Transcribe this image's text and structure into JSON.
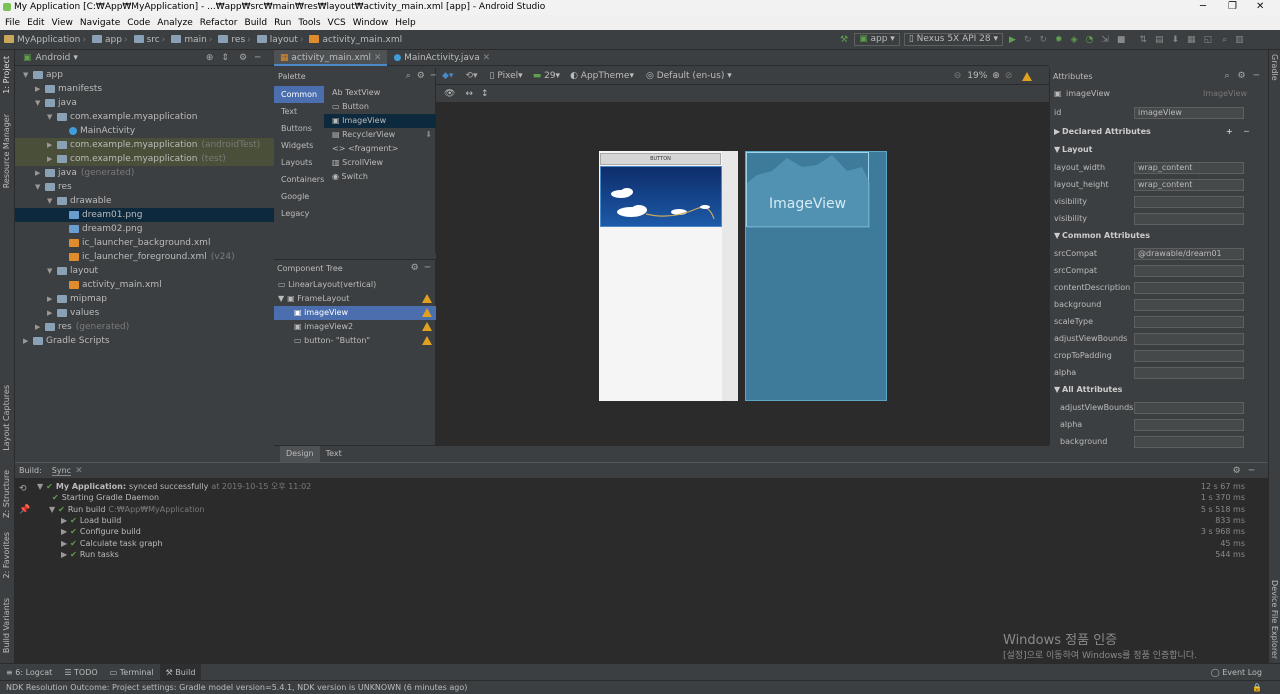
{
  "window": {
    "title": "My Application [C:₩App₩MyApplication] - ...₩app₩src₩main₩res₩layout₩activity_main.xml [app] - Android Studio"
  },
  "menu": [
    "File",
    "Edit",
    "View",
    "Navigate",
    "Code",
    "Analyze",
    "Refactor",
    "Build",
    "Run",
    "Tools",
    "VCS",
    "Window",
    "Help"
  ],
  "breadcrumbs": [
    "MyApplication",
    "app",
    "src",
    "main",
    "res",
    "layout",
    "activity_main.xml"
  ],
  "toolbar": {
    "config": "app",
    "device": "Nexus 5X API 28"
  },
  "project": {
    "view": "Android",
    "items": [
      {
        "label": "app",
        "indent": 0,
        "icon": "folder",
        "open": true
      },
      {
        "label": "manifests",
        "indent": 1,
        "icon": "folder"
      },
      {
        "label": "java",
        "indent": 1,
        "icon": "folder",
        "open": true
      },
      {
        "label": "com.example.myapplication",
        "indent": 2,
        "icon": "folder",
        "open": true
      },
      {
        "label": "MainActivity",
        "indent": 3,
        "icon": "class"
      },
      {
        "label": "com.example.myapplication",
        "suffix": "(androidTest)",
        "indent": 2,
        "icon": "folder",
        "hl": true
      },
      {
        "label": "com.example.myapplication",
        "suffix": "(test)",
        "indent": 2,
        "icon": "folder",
        "hl": true
      },
      {
        "label": "java",
        "suffix": "(generated)",
        "indent": 1,
        "icon": "folder"
      },
      {
        "label": "res",
        "indent": 1,
        "icon": "folder",
        "open": true
      },
      {
        "label": "drawable",
        "indent": 2,
        "icon": "folder",
        "open": true
      },
      {
        "label": "dream01.png",
        "indent": 3,
        "icon": "image",
        "sel": true
      },
      {
        "label": "dream02.png",
        "indent": 3,
        "icon": "image"
      },
      {
        "label": "ic_launcher_background.xml",
        "indent": 3,
        "icon": "xml"
      },
      {
        "label": "ic_launcher_foreground.xml",
        "suffix": "(v24)",
        "indent": 3,
        "icon": "xml"
      },
      {
        "label": "layout",
        "indent": 2,
        "icon": "folder",
        "open": true
      },
      {
        "label": "activity_main.xml",
        "indent": 3,
        "icon": "xml"
      },
      {
        "label": "mipmap",
        "indent": 2,
        "icon": "folder"
      },
      {
        "label": "values",
        "indent": 2,
        "icon": "folder"
      },
      {
        "label": "res",
        "suffix": "(generated)",
        "indent": 1,
        "icon": "folder"
      },
      {
        "label": "Gradle Scripts",
        "indent": 0,
        "icon": "gradle"
      }
    ]
  },
  "left_strip": {
    "project": "1: Project",
    "resource": "Resource Manager",
    "captures": "Layout Captures",
    "structure": "Z: Structure",
    "favorites": "2: Favorites",
    "variants": "Build Variants"
  },
  "right_strip": {
    "gradle": "Gradle",
    "device": "Device File Explorer"
  },
  "tabs": [
    "activity_main.xml",
    "MainActivity.java"
  ],
  "palette": {
    "title": "Palette",
    "categories": [
      "Common",
      "Text",
      "Buttons",
      "Widgets",
      "Layouts",
      "Containers",
      "Google",
      "Legacy"
    ],
    "items": [
      "Ab TextView",
      "Button",
      "ImageView",
      "RecyclerView",
      "<fragment>",
      "ScrollView",
      "Switch"
    ]
  },
  "component_tree": {
    "title": "Component Tree",
    "items": [
      "LinearLayout(vertical)",
      "FrameLayout",
      "imageView",
      "imageView2",
      "button- \"Button\""
    ]
  },
  "design_toolbar": {
    "pixel": "Pixel",
    "api": "29",
    "theme": "AppTheme",
    "locale": "Default (en-us)",
    "zoom": "19%"
  },
  "preview": {
    "button_label": "BUTTON",
    "blueprint_label": "ImageView"
  },
  "editor_tabs": [
    "Design",
    "Text"
  ],
  "attributes": {
    "title": "Attributes",
    "component": "imageView",
    "component_type": "ImageView",
    "id": "imageView",
    "sections": {
      "declared": "Declared Attributes",
      "layout": "Layout",
      "common": "Common Attributes",
      "all": "All Attributes"
    },
    "layout_rows": [
      {
        "k": "layout_width",
        "v": "wrap_content"
      },
      {
        "k": "layout_height",
        "v": "wrap_content"
      },
      {
        "k": "visibility",
        "v": ""
      },
      {
        "k": "visibility",
        "v": ""
      }
    ],
    "common_rows": [
      {
        "k": "srcCompat",
        "v": "@drawable/dream01"
      },
      {
        "k": "srcCompat",
        "v": ""
      },
      {
        "k": "contentDescription",
        "v": ""
      },
      {
        "k": "background",
        "v": ""
      },
      {
        "k": "scaleType",
        "v": ""
      },
      {
        "k": "adjustViewBounds",
        "v": ""
      },
      {
        "k": "cropToPadding",
        "v": ""
      },
      {
        "k": "alpha",
        "v": ""
      }
    ],
    "all_rows": [
      {
        "k": "adjustViewBounds",
        "v": ""
      },
      {
        "k": "alpha",
        "v": ""
      },
      {
        "k": "background",
        "v": ""
      }
    ]
  },
  "build": {
    "label": "Build:",
    "tab": "Sync",
    "lines": [
      {
        "text": "My Application:",
        "rest": "synced successfully",
        "gray": "at 2019-10-15 오후 11:02",
        "indent": 0,
        "time": "12 s 67 ms"
      },
      {
        "text": "Starting Gradle Daemon",
        "indent": 1,
        "time": "1 s 370 ms"
      },
      {
        "text": "Run build",
        "gray": "C:₩App₩MyApplication",
        "indent": 1,
        "time": "5 s 518 ms"
      },
      {
        "text": "Load build",
        "indent": 2,
        "time": "833 ms"
      },
      {
        "text": "Configure build",
        "indent": 2,
        "time": "3 s 968 ms"
      },
      {
        "text": "Calculate task graph",
        "indent": 2,
        "time": "45 ms"
      },
      {
        "text": "Run tasks",
        "indent": 2,
        "time": "544 ms"
      }
    ]
  },
  "tool_tabs": [
    "6: Logcat",
    "TODO",
    "Terminal",
    "Build"
  ],
  "event_log": "Event Log",
  "status": "NDK Resolution Outcome: Project settings: Gradle model version=5.4.1, NDK version is UNKNOWN (6 minutes ago)",
  "watermark": {
    "line1": "Windows 정품 인증",
    "line2": "[설정]으로 이동하여 Windows를 정품 인증합니다."
  }
}
